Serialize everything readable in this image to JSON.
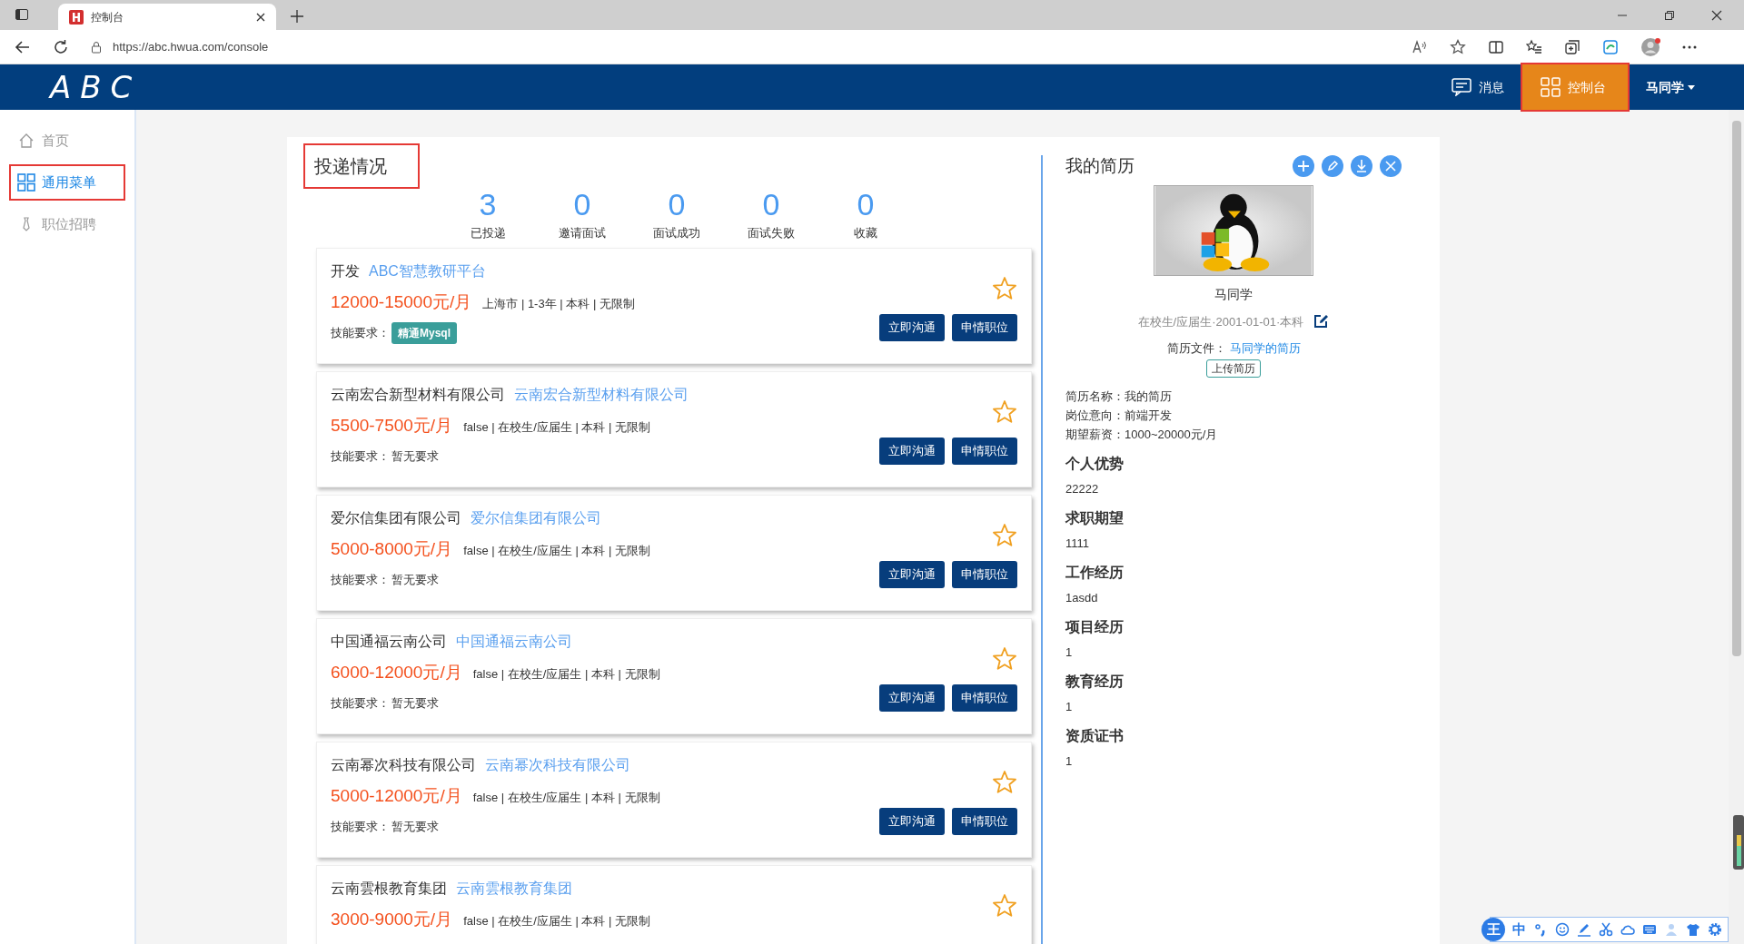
{
  "browser": {
    "tab_title": "控制台",
    "url": "https://abc.hwua.com/console"
  },
  "header": {
    "logo": "ABC",
    "nav": [
      {
        "kind": "message",
        "label": "消息",
        "selected": false,
        "highlighted": false
      },
      {
        "kind": "console",
        "label": "控制台",
        "selected": true,
        "highlighted": true
      }
    ],
    "user": "马同学"
  },
  "sidebar": {
    "items": [
      {
        "kind": "home",
        "label": "首页",
        "selected": false,
        "highlighted": false
      },
      {
        "kind": "grid",
        "label": "通用菜单",
        "selected": true,
        "highlighted": true
      },
      {
        "kind": "tie",
        "label": "职位招聘",
        "selected": false,
        "highlighted": false
      }
    ]
  },
  "delivery": {
    "title": "投递情况",
    "highlighted": true,
    "stats": [
      {
        "value": "3",
        "label": "已投递"
      },
      {
        "value": "0",
        "label": "邀请面试"
      },
      {
        "value": "0",
        "label": "面试成功"
      },
      {
        "value": "0",
        "label": "面试失败"
      },
      {
        "value": "0",
        "label": "收藏"
      }
    ],
    "jobs": [
      {
        "position": "开发",
        "company": "ABC智慧教研平台",
        "salary": "12000-15000元/月",
        "details": "上海市 | 1-3年 | 本科 | 无限制",
        "skills_label": "技能要求：",
        "skills": [
          {
            "kind": "tag",
            "text": "精通Mysql"
          }
        ],
        "buttons": [
          "立即沟通",
          "申情职位"
        ]
      },
      {
        "position": "云南宏合新型材料有限公司",
        "company": "云南宏合新型材料有限公司",
        "salary": "5500-7500元/月",
        "details": "false | 在校生/应届生 | 本科 | 无限制",
        "skills_label": "技能要求：",
        "skills": [
          {
            "kind": "plain",
            "text": "暂无要求"
          }
        ],
        "buttons": [
          "立即沟通",
          "申情职位"
        ]
      },
      {
        "position": "爱尔信集团有限公司",
        "company": "爱尔信集团有限公司",
        "salary": "5000-8000元/月",
        "details": "false | 在校生/应届生 | 本科 | 无限制",
        "skills_label": "技能要求：",
        "skills": [
          {
            "kind": "plain",
            "text": "暂无要求"
          }
        ],
        "buttons": [
          "立即沟通",
          "申情职位"
        ]
      },
      {
        "position": "中国通福云南公司",
        "company": "中国通福云南公司",
        "salary": "6000-12000元/月",
        "details": "false | 在校生/应届生 | 本科 | 无限制",
        "skills_label": "技能要求：",
        "skills": [
          {
            "kind": "plain",
            "text": "暂无要求"
          }
        ],
        "buttons": [
          "立即沟通",
          "申情职位"
        ]
      },
      {
        "position": "云南幂次科技有限公司",
        "company": "云南幂次科技有限公司",
        "salary": "5000-12000元/月",
        "details": "false | 在校生/应届生 | 本科 | 无限制",
        "skills_label": "技能要求：",
        "skills": [
          {
            "kind": "plain",
            "text": "暂无要求"
          }
        ],
        "buttons": [
          "立即沟通",
          "申情职位"
        ]
      },
      {
        "position": "云南雲根教育集团",
        "company": "云南雲根教育集团",
        "salary": "3000-9000元/月",
        "details": "false | 在校生/应届生 | 本科 | 无限制"
      }
    ]
  },
  "resume": {
    "title": "我的简历",
    "name": "马同学",
    "meta": "在校生/应届生·2001-01-01·本科",
    "file_label": "简历文件：",
    "file_link": "马同学的简历",
    "upload": "上传简历",
    "info": [
      "简历名称：我的简历",
      "岗位意向：前端开发",
      "期望薪资：1000~20000元/月"
    ],
    "sections": [
      {
        "heading": "个人优势",
        "value": "22222"
      },
      {
        "heading": "求职期望",
        "value": "1111"
      },
      {
        "heading": "工作经历",
        "value": "1asdd"
      },
      {
        "heading": "项目经历",
        "value": "1"
      },
      {
        "heading": "教育经历",
        "value": "1"
      },
      {
        "heading": "资质证书",
        "value": "1"
      }
    ]
  },
  "ime_toolbar": {
    "logo": "王",
    "mode": "中"
  }
}
